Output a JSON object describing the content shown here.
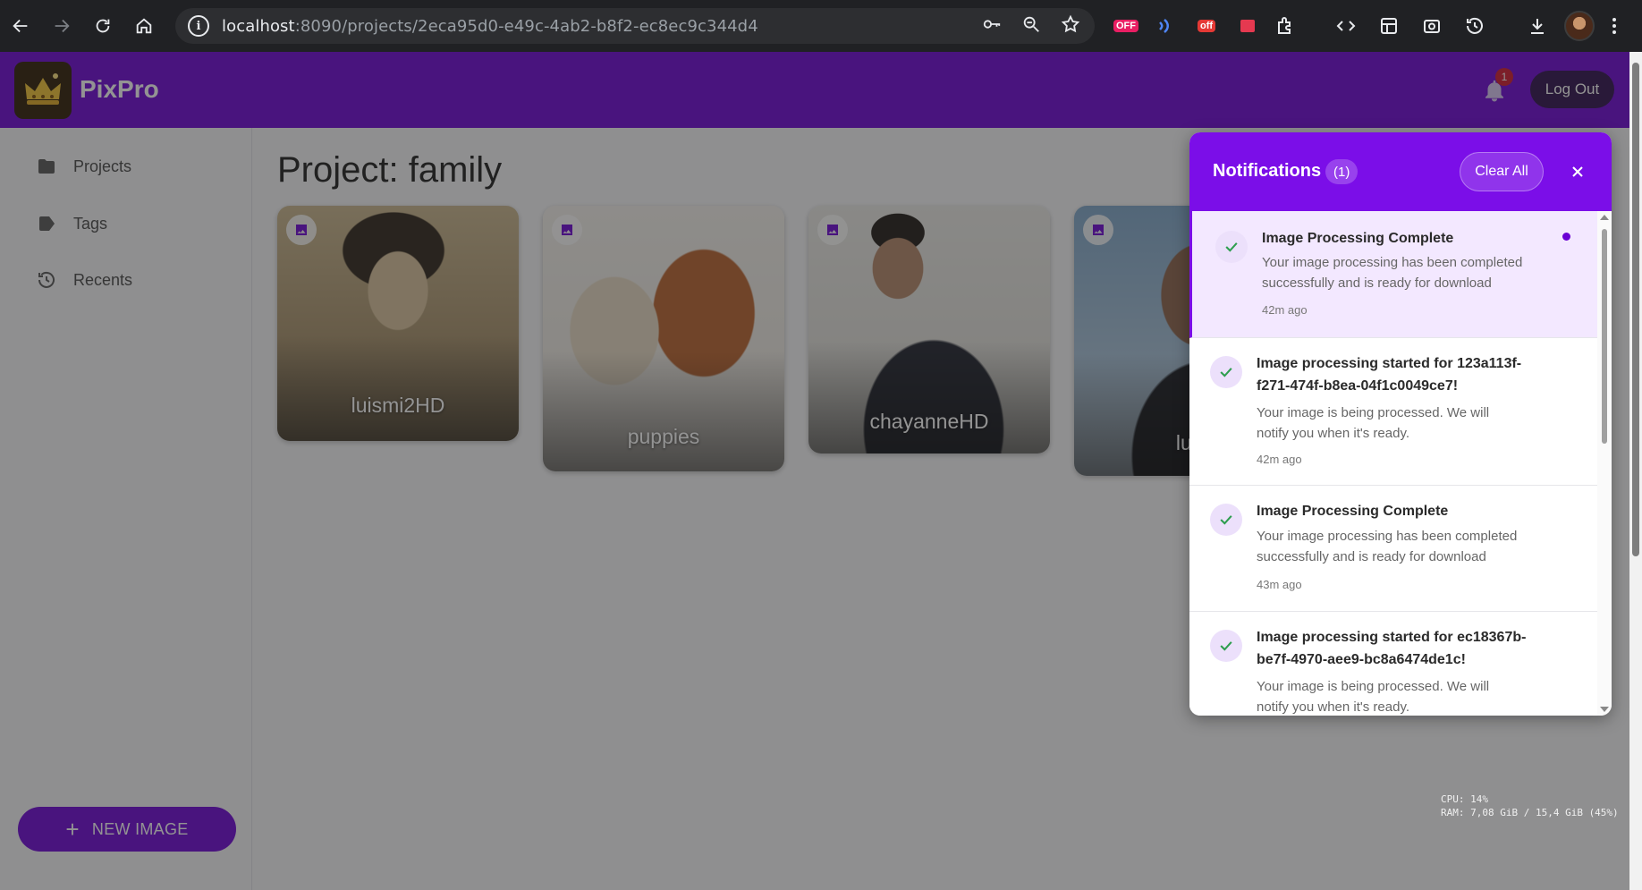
{
  "browser": {
    "url_host": "localhost",
    "url_rest": ":8090/projects/2eca95d0-e49c-4ab2-b8f2-ec8ec9c344d4",
    "ext_badge_1": "OFF",
    "ext_badge_2": "off"
  },
  "app": {
    "brand": "PixPro",
    "notification_badge": "1",
    "logout_label": "Log Out"
  },
  "sidebar": {
    "items": [
      {
        "label": "Projects",
        "icon": "folder-icon"
      },
      {
        "label": "Tags",
        "icon": "tag-icon"
      },
      {
        "label": "Recents",
        "icon": "history-icon"
      }
    ],
    "new_image_label": "NEW IMAGE"
  },
  "main": {
    "title": "Project: family",
    "cards": [
      {
        "label": "luismi2HD"
      },
      {
        "label": "puppies"
      },
      {
        "label": "chayanneHD"
      },
      {
        "label": "luisr"
      }
    ]
  },
  "notifications": {
    "title": "Notifications",
    "count": "(1)",
    "clear_all_label": "Clear All",
    "items": [
      {
        "title": "Image Processing Complete",
        "body": "Your image processing has been completed successfully and is ready for download",
        "time": "42m ago",
        "unread": true
      },
      {
        "title": "Image processing started for 123a113f-f271-474f-b8ea-04f1c0049ce7!",
        "body": "Your image is being processed. We will notify you when it's ready.",
        "time": "42m ago",
        "unread": false
      },
      {
        "title": "Image Processing Complete",
        "body": "Your image processing has been completed successfully and is ready for download",
        "time": "43m ago",
        "unread": false
      },
      {
        "title": "Image processing started for ec18367b-be7f-4970-aee9-bc8a6474de1c!",
        "body": "Your image is being processed. We will notify you when it's ready.",
        "time": "",
        "unread": false
      }
    ]
  },
  "system_monitor": {
    "cpu": "CPU: 14%",
    "ram": "RAM: 7,08 GiB / 15,4 GiB (45%)"
  },
  "colors": {
    "primary": "#6a00d4",
    "panel_header": "#7b0ee8",
    "unread_bg": "#f3e8ff",
    "success": "#2e9e4f"
  }
}
